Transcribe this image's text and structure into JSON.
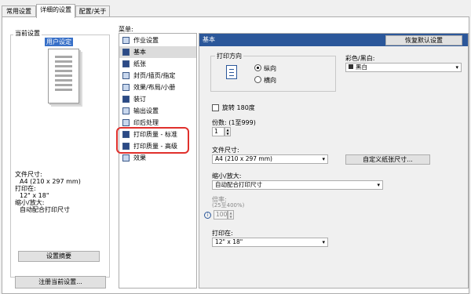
{
  "tabs": [
    "常用设置",
    "详细的设置",
    "配置/关于"
  ],
  "left": {
    "group_title": "当前设置",
    "preview_badge": "用户设定",
    "summary": {
      "paper_size_label": "文件尺寸:",
      "paper_size_value": "A4 (210 x 297 mm)",
      "print_on_label": "打印在:",
      "print_on_value": "12\" x 18\"",
      "scale_label": "缩小/放大:",
      "scale_value": "自动配合打印尺寸"
    },
    "settings_summary_button": "设置摘要",
    "register_button": "注册当前设置..."
  },
  "menu": {
    "label": "菜单:",
    "items": [
      {
        "label": "作业设置",
        "icon": "job-settings-icon"
      },
      {
        "label": "基本",
        "icon": "basic-icon"
      },
      {
        "label": "纸张",
        "icon": "paper-icon"
      },
      {
        "label": "封页/插页/指定",
        "icon": "cover-icon"
      },
      {
        "label": "效果/布局/小册",
        "icon": "layout-icon"
      },
      {
        "label": "装订",
        "icon": "binding-icon"
      },
      {
        "label": "输出设置",
        "icon": "output-icon"
      },
      {
        "label": "印后处理",
        "icon": "finishing-icon"
      },
      {
        "label": "打印质量 - 标准",
        "icon": "quality-standard-icon"
      },
      {
        "label": "打印质量 - 高级",
        "icon": "quality-advanced-icon"
      },
      {
        "label": "效果",
        "icon": "effects-icon"
      }
    ],
    "selected": "基本"
  },
  "panel": {
    "title": "基本",
    "restore_button": "恢复默认设置",
    "orientation": {
      "label": "打印方向",
      "portrait": "纵向",
      "landscape": "横向",
      "selected": "纵向"
    },
    "color": {
      "label": "彩色/黑白:",
      "value": "黑白"
    },
    "rotate180": "旋转 180度",
    "copies": {
      "label": "份数: (1至999)",
      "value": "1"
    },
    "paper_size": {
      "label": "文件尺寸:",
      "value": "A4 (210 x 297 mm)",
      "custom_button": "自定义纸张尺寸..."
    },
    "scale": {
      "label": "缩小/放大:",
      "value": "自动配合打印尺寸"
    },
    "ratio": {
      "label": "倍率:",
      "hint": "(25至400%)",
      "value": "100"
    },
    "print_on": {
      "label": "打印在:",
      "value": "12\" x 18\""
    }
  },
  "colors": {
    "header_blue": "#2b579a",
    "highlight_red": "#e0302c"
  }
}
